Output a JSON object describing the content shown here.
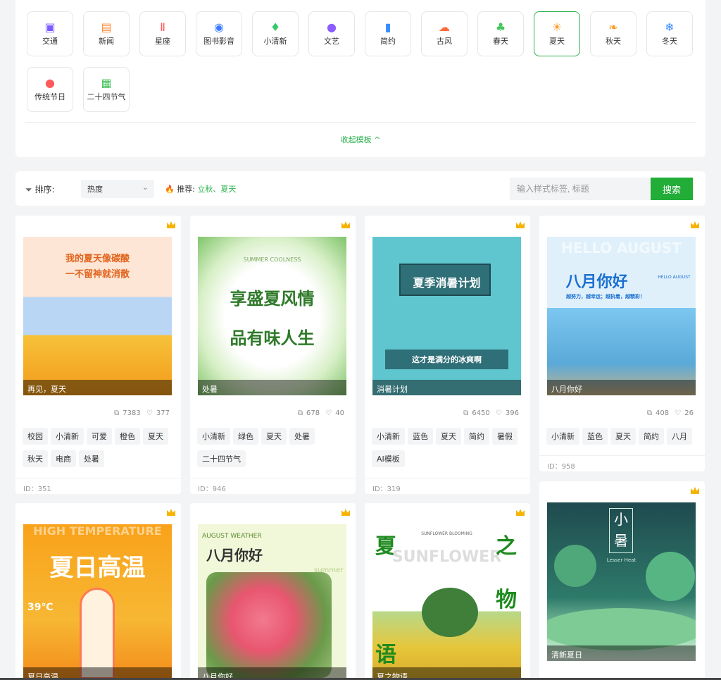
{
  "categories": [
    {
      "label": "交通",
      "icon": "bus-icon",
      "color": "#7b5cff"
    },
    {
      "label": "新闻",
      "icon": "newspaper-icon",
      "color": "#ff8a34"
    },
    {
      "label": "星座",
      "icon": "gemini-icon",
      "color": "#ff5a5a"
    },
    {
      "label": "图书影音",
      "icon": "film-reel-icon",
      "color": "#3a7bff"
    },
    {
      "label": "小清新",
      "icon": "dress-icon",
      "color": "#39c66d"
    },
    {
      "label": "文艺",
      "icon": "palette-icon",
      "color": "#8b5cff"
    },
    {
      "label": "简约",
      "icon": "shapes-icon",
      "color": "#3a8cff"
    },
    {
      "label": "古风",
      "icon": "cloud-icon",
      "color": "#ff6a3d"
    },
    {
      "label": "春天",
      "icon": "sprout-icon",
      "color": "#45c45a"
    },
    {
      "label": "夏天",
      "icon": "sun-icon",
      "color": "#ff9a1f"
    },
    {
      "label": "秋天",
      "icon": "leaf-icon",
      "color": "#ff9a1f"
    },
    {
      "label": "冬天",
      "icon": "snowflake-icon",
      "color": "#3a8cff"
    },
    {
      "label": "传统节日",
      "icon": "balloon-icon",
      "color": "#ff5a5a"
    },
    {
      "label": "二十四节气",
      "icon": "calendar-icon",
      "color": "#45c45a"
    }
  ],
  "active_category": "夏天",
  "collapse_label": "收起模板 ^",
  "filter": {
    "sort_label": "排序:",
    "sort_value": "热度",
    "recommend_label": "推荐:",
    "recommend_tags": "立秋、夏天",
    "search_placeholder": "输入样式标签, 标题",
    "search_button": "搜索"
  },
  "cards": [
    {
      "caption": "再见，夏天",
      "title_lines": [
        "我的夏天像碳酸",
        "一不留神就消散"
      ],
      "copies": "7383",
      "likes": "377",
      "tags": [
        "校园",
        "小清新",
        "可爱",
        "橙色",
        "夏天",
        "秋天",
        "电商",
        "处暑"
      ],
      "id": "ID：351"
    },
    {
      "caption": "处暑",
      "title_lines": [
        "SUMMER COOLNESS",
        "享盛夏风情",
        "品有味人生"
      ],
      "copies": "678",
      "likes": "40",
      "tags": [
        "小清新",
        "绿色",
        "夏天",
        "处暑",
        "二十四节气"
      ],
      "id": "ID：946"
    },
    {
      "caption": "消暑计划",
      "title_lines": [
        "夏季消暑计划",
        "这才是满分的冰爽啊"
      ],
      "copies": "6450",
      "likes": "396",
      "tags": [
        "小清新",
        "蓝色",
        "夏天",
        "简约",
        "暑假",
        "AI模板"
      ],
      "id": "ID：319"
    },
    {
      "caption": "八月你好",
      "title_lines": [
        "HELLO AUGUST",
        "八月你好",
        "越努力，越幸运；越执着，越精彩！",
        "HELLO AUGUST"
      ],
      "copies": "408",
      "likes": "26",
      "tags": [
        "小清新",
        "蓝色",
        "夏天",
        "简约",
        "八月"
      ],
      "id": "ID：958"
    },
    {
      "caption": "夏日高温",
      "title_lines": [
        "HIGH TEMPERATURE",
        "夏日高温",
        "39℃"
      ]
    },
    {
      "caption": "八月你好",
      "title_lines": [
        "AUGUST WEATHER",
        "八月你好",
        "summer"
      ]
    },
    {
      "caption": "夏之物语",
      "title_lines": [
        "夏",
        "SUNFLOWER BLOOMING",
        "SUNFLOWER",
        "之",
        "物",
        "语"
      ]
    },
    {
      "caption": "清新夏日",
      "title_lines": [
        "小",
        "暑",
        "Lesser Heat"
      ]
    }
  ]
}
